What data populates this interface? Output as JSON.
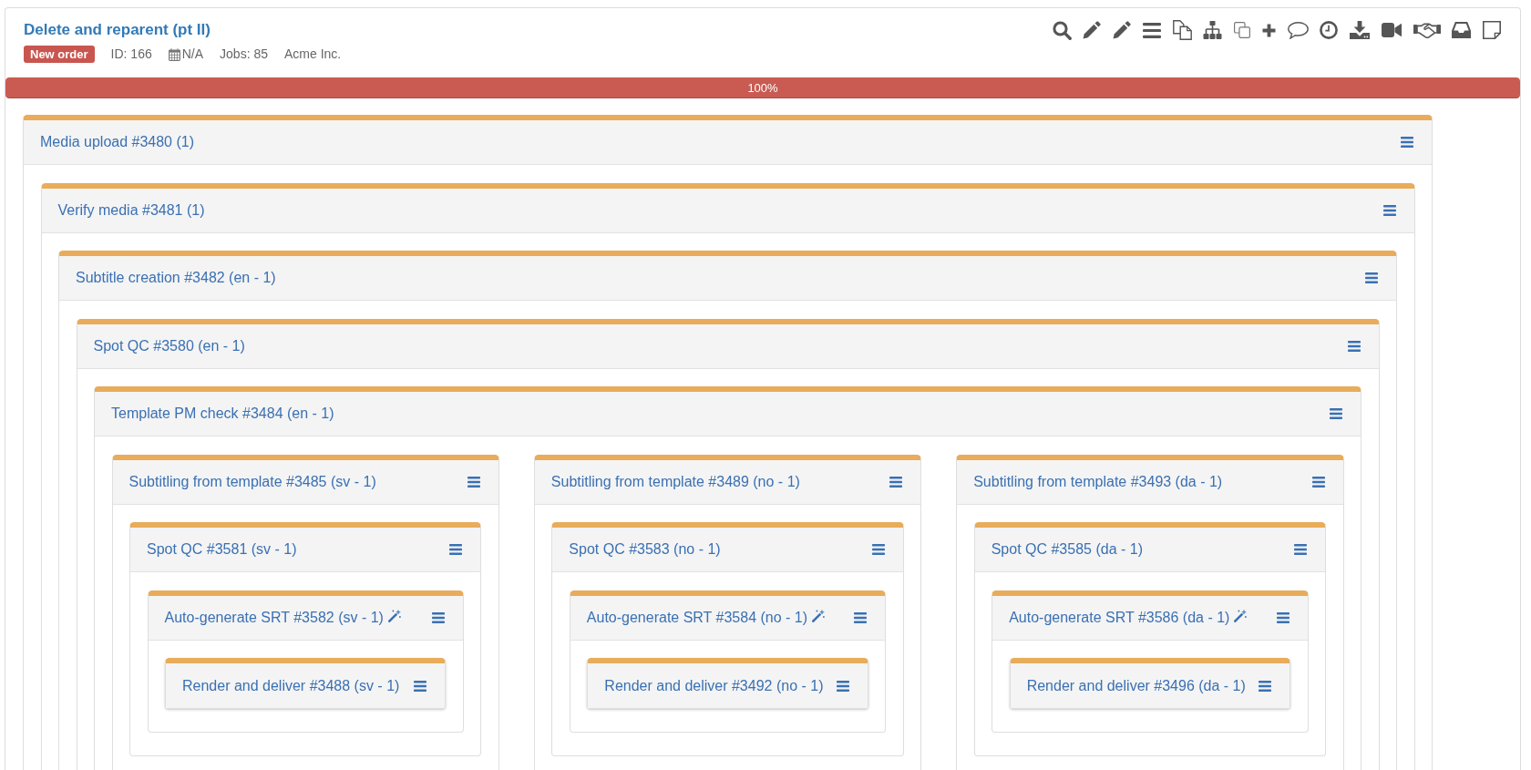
{
  "header": {
    "title": "Delete and reparent (pt II)",
    "badge": "New order",
    "meta": {
      "id": "ID: 166",
      "date": "N/A",
      "jobs": "Jobs: 85",
      "client": "Acme Inc."
    }
  },
  "progress": {
    "level": 1,
    "label": "100%"
  },
  "tasks": [
    {
      "label": "Media upload #3480 (1)",
      "automated": false,
      "children": [
        {
          "label": "Verify media #3481 (1)",
          "automated": false,
          "children": [
            {
              "label": "Subtitle creation #3482 (en - 1)",
              "automated": false,
              "children": [
                {
                  "label": "Spot QC #3580 (en - 1)",
                  "automated": false,
                  "children": [
                    {
                      "label": "Template PM check #3484 (en - 1)",
                      "automated": false,
                      "children": [
                        {
                          "label": "Subtitling from template #3485 (sv - 1)",
                          "automated": false,
                          "children": [
                            {
                              "label": "Spot QC #3581 (sv - 1)",
                              "automated": false,
                              "children": [
                                {
                                  "label": "Auto-generate SRT #3582 (sv - 1)",
                                  "automated": true,
                                  "children": [
                                    {
                                      "label": "Render and deliver #3488 (sv - 1)",
                                      "automated": false
                                    }
                                  ]
                                }
                              ]
                            }
                          ]
                        },
                        {
                          "label": "Subtitling from template #3489 (no - 1)",
                          "automated": false,
                          "children": [
                            {
                              "label": "Spot QC #3583 (no - 1)",
                              "automated": false,
                              "children": [
                                {
                                  "label": "Auto-generate SRT #3584 (no - 1)",
                                  "automated": true,
                                  "children": [
                                    {
                                      "label": "Render and deliver #3492 (no - 1)",
                                      "automated": false
                                    }
                                  ]
                                }
                              ]
                            }
                          ]
                        },
                        {
                          "label": "Subtitling from template #3493 (da - 1)",
                          "automated": false,
                          "children": [
                            {
                              "label": "Spot QC #3585 (da - 1)",
                              "automated": false,
                              "children": [
                                {
                                  "label": "Auto-generate SRT #3586 (da - 1)",
                                  "automated": true,
                                  "children": [
                                    {
                                      "label": "Render and deliver #3496 (da - 1)",
                                      "automated": false
                                    }
                                  ]
                                }
                              ]
                            }
                          ]
                        }
                      ]
                    }
                  ]
                }
              ]
            }
          ]
        }
      ]
    }
  ]
}
